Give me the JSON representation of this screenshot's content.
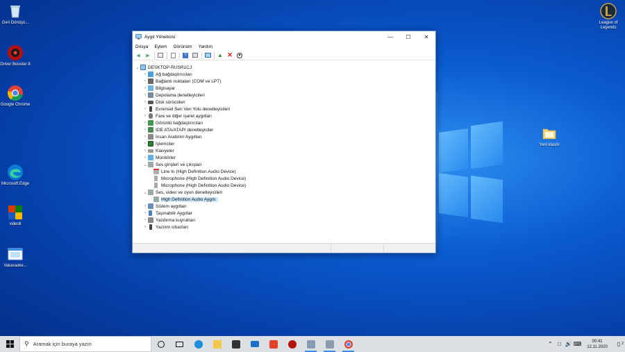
{
  "desktop": {
    "icons": [
      {
        "label": "Geri Dönüşü...",
        "icon": "recycle-bin-icon"
      },
      {
        "label": "Driver Booster 8",
        "icon": "driver-booster-icon"
      },
      {
        "label": "Google Chrome",
        "icon": "chrome-icon"
      },
      {
        "label": "Microsoft Edge",
        "icon": "edge-icon"
      },
      {
        "label": "videoll",
        "icon": "office-icon"
      },
      {
        "label": "Vakaraoke...",
        "icon": "window-icon"
      },
      {
        "label": "League of Legends",
        "icon": "league-icon"
      },
      {
        "label": "Yeni klasör",
        "icon": "folder-icon"
      }
    ]
  },
  "window": {
    "title": "Aygıt Yöneticisi",
    "menu": [
      "Dosya",
      "Eylem",
      "Görünüm",
      "Yardım"
    ],
    "tree": {
      "root": "DESKTOP-RUSR1CJ",
      "items": [
        "Ağ bağdaştırıcıları",
        "Bağlantı noktaları (COM ve LPT)",
        "Bilgisayar",
        "Depolama denetleyicileri",
        "Disk sürücüleri",
        "Evrensel Seri Veri Yolu denetleyicileri",
        "Fare ve diğer işaret aygıtları",
        "Görüntü bağdaştırıcıları",
        "IDE ATA/ATAPI denetleyiciler",
        "İnsan Arabirim Aygıtları",
        "İşlemciler",
        "Klavyeler",
        "Monitörler",
        "Ses girişleri ve çıkışları",
        "Line In (High Definition Audio Device)",
        "Microphone (High Definition Audio Device)",
        "Microphone (High Definition Audio Device)",
        "Ses, video ve oyun denetleyicileri",
        "High Definition Audio Aygıtı",
        "Sistem aygıtları",
        "Taşınabilir Aygıtlar",
        "Yazdırma kuyrukları",
        "Yazılım cihazları"
      ]
    }
  },
  "taskbar": {
    "search_placeholder": "Aramak için buraya yazın",
    "time": "00:41",
    "date": "12.11.2020",
    "notification_count": "2"
  },
  "colors": {
    "accent": "#0078d7",
    "selection": "#cce8ff"
  }
}
